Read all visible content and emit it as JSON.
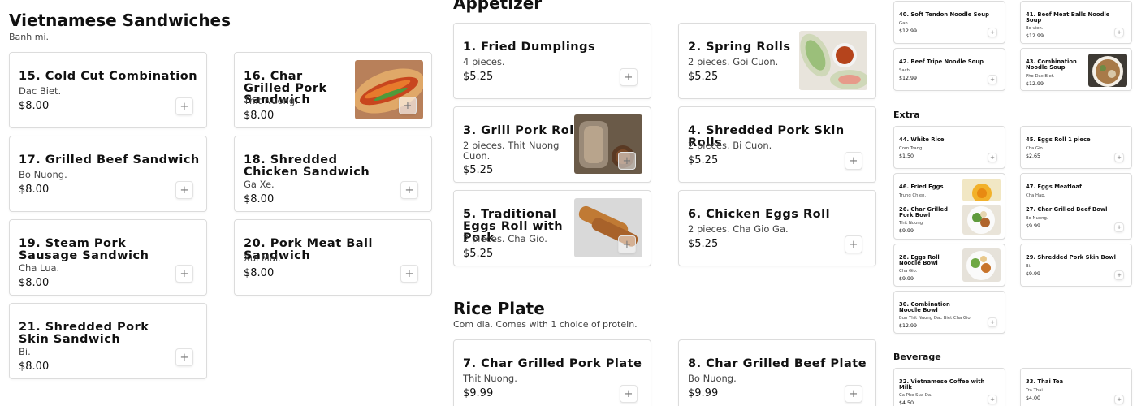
{
  "sandwiches": {
    "title": "Vietnamese Sandwiches",
    "subtitle": "Banh mi.",
    "items": [
      {
        "name": "15. Cold Cut Combination",
        "desc": "Dac Biet.",
        "price": "$8.00"
      },
      {
        "name": "16. Char Grilled Pork Sandwich",
        "desc": "Thit Nuong.",
        "price": "$8.00"
      },
      {
        "name": "17. Grilled Beef Sandwich",
        "desc": "Bo Nuong.",
        "price": "$8.00"
      },
      {
        "name": "18. Shredded Chicken Sandwich",
        "desc": "Ga Xe.",
        "price": "$8.00"
      },
      {
        "name": "19. Steam Pork Sausage Sandwich",
        "desc": "Cha Lua.",
        "price": "$8.00"
      },
      {
        "name": "20. Pork Meat Ball Sandwich",
        "desc": "Xui Mai.",
        "price": "$8.00"
      },
      {
        "name": "21. Shredded Pork Skin Sandwich",
        "desc": "Bi.",
        "price": "$8.00"
      }
    ]
  },
  "appetizer": {
    "title": "Appetizer",
    "items": [
      {
        "name": "1. Fried Dumplings",
        "desc": "4 pieces.",
        "price": "$5.25"
      },
      {
        "name": "2. Spring Rolls",
        "desc": "2 pieces. Goi Cuon.",
        "price": "$5.25"
      },
      {
        "name": "3. Grill Pork Roll",
        "desc": "2 pieces. Thit Nuong Cuon.",
        "price": "$5.25"
      },
      {
        "name": "4. Shredded Pork Skin Rolls",
        "desc": "2 pieces. Bi Cuon.",
        "price": "$5.25"
      },
      {
        "name": "5. Traditional Eggs Roll with Pork",
        "desc": "2 pieces. Cha Gio.",
        "price": "$5.25"
      },
      {
        "name": "6. Chicken Eggs Roll",
        "desc": "2 pieces. Cha Gio Ga.",
        "price": "$5.25"
      }
    ]
  },
  "rice_plate": {
    "title": "Rice Plate",
    "subtitle": "Com dia. Comes with 1 choice of protein.",
    "items": [
      {
        "name": "7. Char Grilled Pork Plate",
        "desc": "Thit Nuong.",
        "price": "$9.99"
      },
      {
        "name": "8. Char Grilled Beef Plate",
        "desc": "Bo Nuong.",
        "price": "$9.99"
      }
    ]
  },
  "soups": {
    "items": [
      {
        "name": "40. Soft Tendon Noodle Soup",
        "desc": "Gan.",
        "price": "$12.99"
      },
      {
        "name": "41. Beef Meat Balls Noodle Soup",
        "desc": "Bo vien.",
        "price": "$12.99"
      },
      {
        "name": "42. Beef Tripe Noodle Soup",
        "desc": "Sach.",
        "price": "$12.99"
      },
      {
        "name": "43. Combination Noodle Soup",
        "desc": "Pho Dac Biet.",
        "price": "$12.99"
      }
    ]
  },
  "extra": {
    "title": "Extra",
    "items": [
      {
        "name": "44. White Rice",
        "desc": "Com Trang.",
        "price": "$1.50"
      },
      {
        "name": "45. Eggs Roll 1 piece",
        "desc": "Cha Gio.",
        "price": "$2.65"
      },
      {
        "name": "46. Fried Eggs",
        "desc": "Trung Chien.",
        "price": ""
      },
      {
        "name": "47. Eggs Meatloaf",
        "desc": "Cha Hap.",
        "price": ""
      },
      {
        "name": "26. Char Grilled Pork Bowl",
        "desc": "Thit Nuong",
        "price": "$9.99"
      },
      {
        "name": "27. Char Grilled Beef Bowl",
        "desc": "Bo Nuong.",
        "price": "$9.99"
      },
      {
        "name": "28. Eggs Roll Noodle Bowl",
        "desc": "Cha Gio.",
        "price": "$9.99"
      },
      {
        "name": "29. Shredded Pork Skin Bowl",
        "desc": "Bi.",
        "price": "$9.99"
      },
      {
        "name": "30. Combination Noodle Bowl",
        "desc": "Bun Thit Nuong Dac Biet Cha Gio.",
        "price": "$12.99"
      }
    ]
  },
  "beverage": {
    "title": "Beverage",
    "items": [
      {
        "name": "32. Vietnamese Coffee with Milk",
        "desc": "Ca Phe Sua Da.",
        "price": "$4.50"
      },
      {
        "name": "33. Thai Tea",
        "desc": "Tra Thai.",
        "price": "$4.00"
      }
    ]
  },
  "ui": {
    "add_label": "+"
  },
  "icons": [
    "plus-icon",
    "food-photo"
  ],
  "colors": {
    "border": "#dcdcdc",
    "text": "#111111",
    "muted": "#444444"
  }
}
